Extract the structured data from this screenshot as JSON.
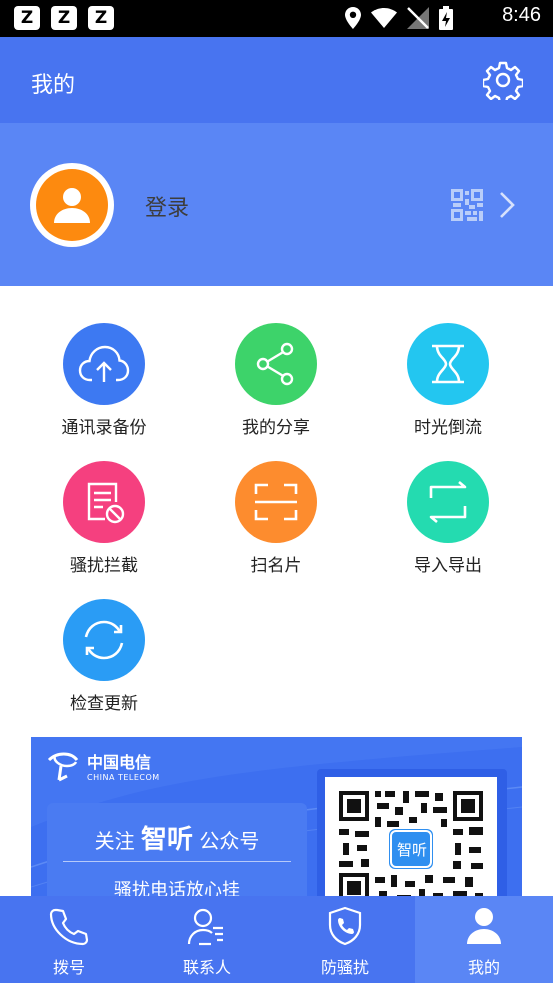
{
  "status_bar": {
    "notifications": [
      "Z",
      "Z",
      "Z"
    ],
    "time": "8:46"
  },
  "header": {
    "title": "我的",
    "settings_icon": "gear-icon"
  },
  "profile": {
    "login_label": "登录",
    "avatar_icon": "person-icon",
    "qr_icon": "qr-code-icon",
    "arrow_icon": "chevron-right-icon"
  },
  "features": [
    {
      "label": "通讯录备份",
      "icon": "cloud-upload-icon",
      "color": "#3d79f2"
    },
    {
      "label": "我的分享",
      "icon": "share-icon",
      "color": "#3dd36a"
    },
    {
      "label": "时光倒流",
      "icon": "hourglass-icon",
      "color": "#23c6f0"
    },
    {
      "label": "骚扰拦截",
      "icon": "block-list-icon",
      "color": "#f5407f"
    },
    {
      "label": "扫名片",
      "icon": "scan-icon",
      "color": "#fd8c2e"
    },
    {
      "label": "导入导出",
      "icon": "import-export-icon",
      "color": "#24dbb0"
    },
    {
      "label": "检查更新",
      "icon": "refresh-icon",
      "color": "#2a9cf5"
    }
  ],
  "banner": {
    "brand_cn": "中国电信",
    "brand_en": "CHINA TELECOM",
    "promo_prefix": "关注",
    "promo_name": "智听",
    "promo_suffix": "公众号",
    "promo_subtitle": "骚扰电话放心挂",
    "qr_badge": "智听"
  },
  "tabbar": [
    {
      "label": "拨号",
      "icon": "phone-icon",
      "active": false
    },
    {
      "label": "联系人",
      "icon": "contacts-icon",
      "active": false
    },
    {
      "label": "防骚扰",
      "icon": "shield-phone-icon",
      "active": false
    },
    {
      "label": "我的",
      "icon": "person-icon",
      "active": true
    }
  ],
  "colors": {
    "header_blue": "#4874f0",
    "profile_blue": "#5a86f5",
    "avatar_orange": "#fd8a0f"
  }
}
